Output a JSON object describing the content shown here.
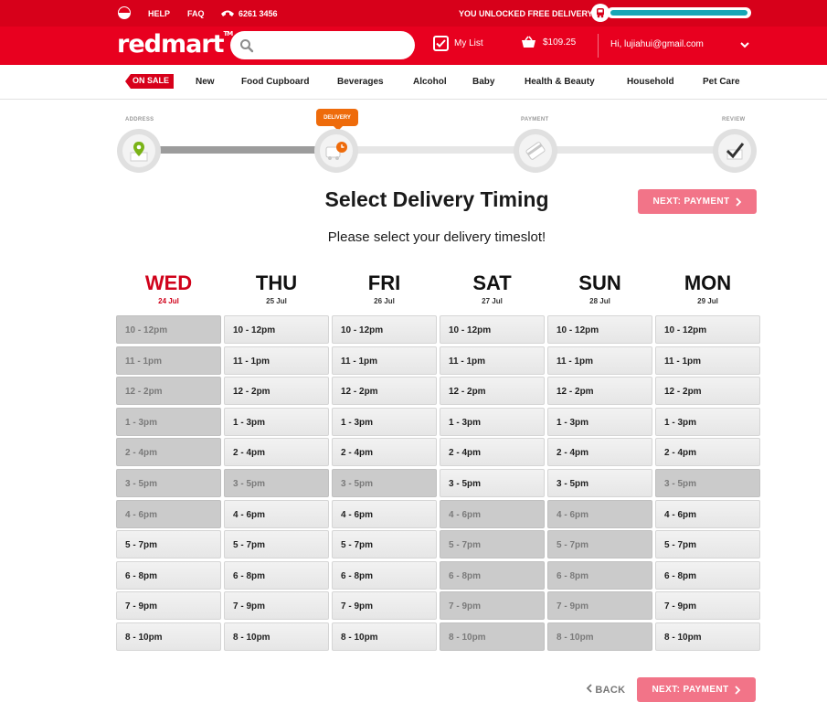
{
  "topbar": {
    "help": "HELP",
    "faq": "FAQ",
    "phone": "6261 3456",
    "delivery_message": "YOU UNLOCKED FREE DELIVERY!",
    "progress_fraction": 1.0
  },
  "header": {
    "logo": "redmart",
    "logo_mark": "TM",
    "search_placeholder": "",
    "my_list": "My List",
    "cart_total": "$109.25",
    "account": "Hi, lujiahui@gmail.com"
  },
  "nav": {
    "on_sale": "ON SALE",
    "categories": [
      "New",
      "Food Cupboard",
      "Beverages",
      "Alcohol",
      "Baby",
      "Health & Beauty",
      "Household",
      "Pet Care"
    ]
  },
  "steps": {
    "items": [
      "ADDRESS",
      "DELIVERY",
      "PAYMENT",
      "REVIEW"
    ],
    "current": "DELIVERY"
  },
  "page": {
    "title": "Select Delivery Timing",
    "subtitle": "Please select your delivery timeslot!",
    "next_label": "NEXT: PAYMENT",
    "back_label": "BACK"
  },
  "colors": {
    "brand_red": "#e8001f",
    "next_button": "#f27488",
    "step_active": "#ee6b0b",
    "step_done": "#7ab317",
    "progress_fill": "#16a6b6"
  },
  "slot_labels": [
    "10 - 12pm",
    "11 - 1pm",
    "12 - 2pm",
    "1 - 3pm",
    "2 - 4pm",
    "3 - 5pm",
    "4 - 6pm",
    "5 - 7pm",
    "6 - 8pm",
    "7 - 9pm",
    "8 - 10pm"
  ],
  "days": [
    {
      "name": "WED",
      "date": "24 Jul",
      "today": true,
      "unavailable": [
        0,
        1,
        2,
        3,
        4,
        5,
        6
      ]
    },
    {
      "name": "THU",
      "date": "25 Jul",
      "today": false,
      "unavailable": [
        5
      ]
    },
    {
      "name": "FRI",
      "date": "26 Jul",
      "today": false,
      "unavailable": [
        5
      ]
    },
    {
      "name": "SAT",
      "date": "27 Jul",
      "today": false,
      "unavailable": [
        6,
        7,
        8,
        9,
        10
      ]
    },
    {
      "name": "SUN",
      "date": "28 Jul",
      "today": false,
      "unavailable": [
        6,
        7,
        8,
        9,
        10
      ]
    },
    {
      "name": "MON",
      "date": "29 Jul",
      "today": false,
      "unavailable": [
        5
      ]
    }
  ]
}
